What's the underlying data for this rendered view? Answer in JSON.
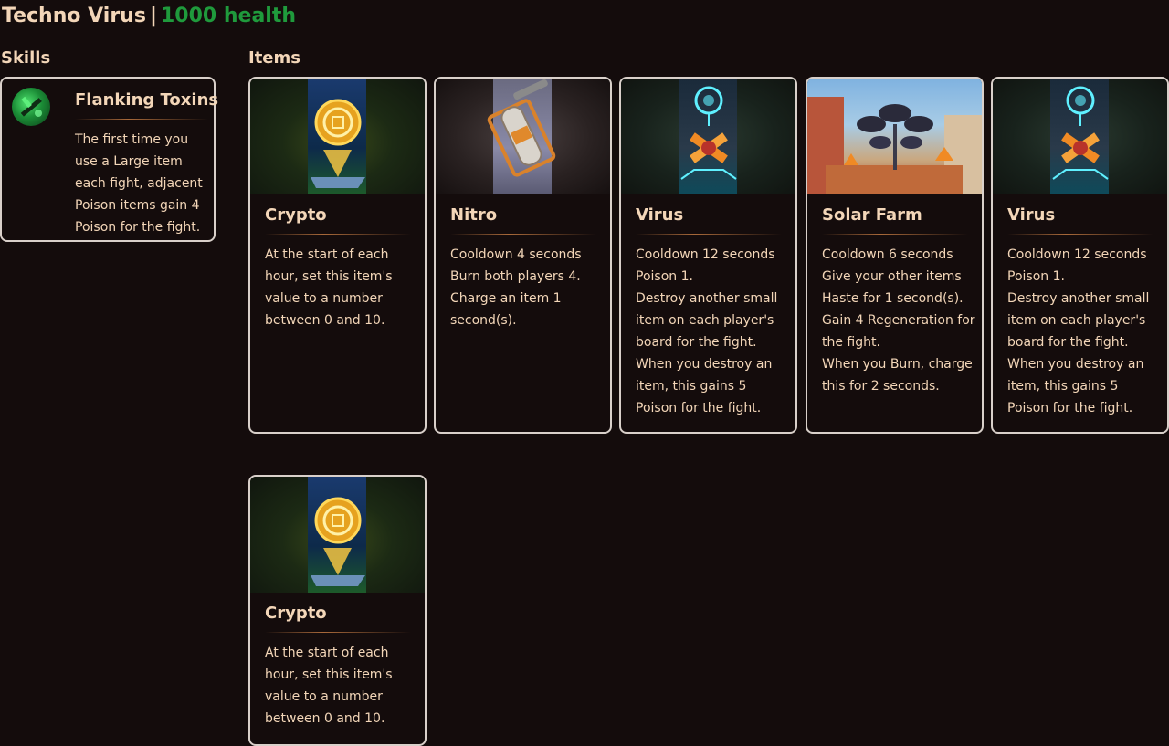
{
  "header": {
    "name": "Techno Virus",
    "separator": "|",
    "health": "1000 health"
  },
  "sections": {
    "skills_label": "Skills",
    "items_label": "Items"
  },
  "skill": {
    "icon": "poison-dagger-icon",
    "title": "Flanking Toxins",
    "description": "The first time you use a Large item each fight, adjacent Poison items gain 4 Poison for the fight."
  },
  "items": [
    {
      "title": "Crypto",
      "art": "crypto-coin-art",
      "lines": [
        "At the start of each hour, set this item's value to a number between 0 and 10."
      ]
    },
    {
      "title": "Nitro",
      "art": "nitro-tank-art",
      "lines": [
        "Cooldown 4 seconds",
        "Burn both players 4.",
        "Charge an item 1 second(s)."
      ]
    },
    {
      "title": "Virus",
      "art": "virus-chip-art",
      "lines": [
        "Cooldown 12 seconds",
        "Poison 1.",
        "Destroy another small item on each player's board for the fight.",
        "When you destroy an item, this gains 5 Poison for the fight."
      ]
    },
    {
      "title": "Solar Farm",
      "art": "solar-farm-art",
      "lines": [
        "Cooldown 6 seconds",
        "Give your other items Haste for 1 second(s).",
        "Gain 4 Regeneration for the fight.",
        "When you Burn, charge this for 2 seconds."
      ]
    },
    {
      "title": "Virus",
      "art": "virus-chip-art",
      "lines": [
        "Cooldown 12 seconds",
        "Poison 1.",
        "Destroy another small item on each player's board for the fight.",
        "When you destroy an item, this gains 5 Poison for the fight."
      ]
    },
    {
      "title": "Crypto",
      "art": "crypto-coin-art",
      "lines": [
        "At the start of each hour, set this item's value to a number between 0 and 10."
      ]
    }
  ],
  "colors": {
    "background": "#140c0c",
    "text": "#f3d6b8",
    "health": "#1f9a3c",
    "card_border": "#d9d0ca"
  }
}
